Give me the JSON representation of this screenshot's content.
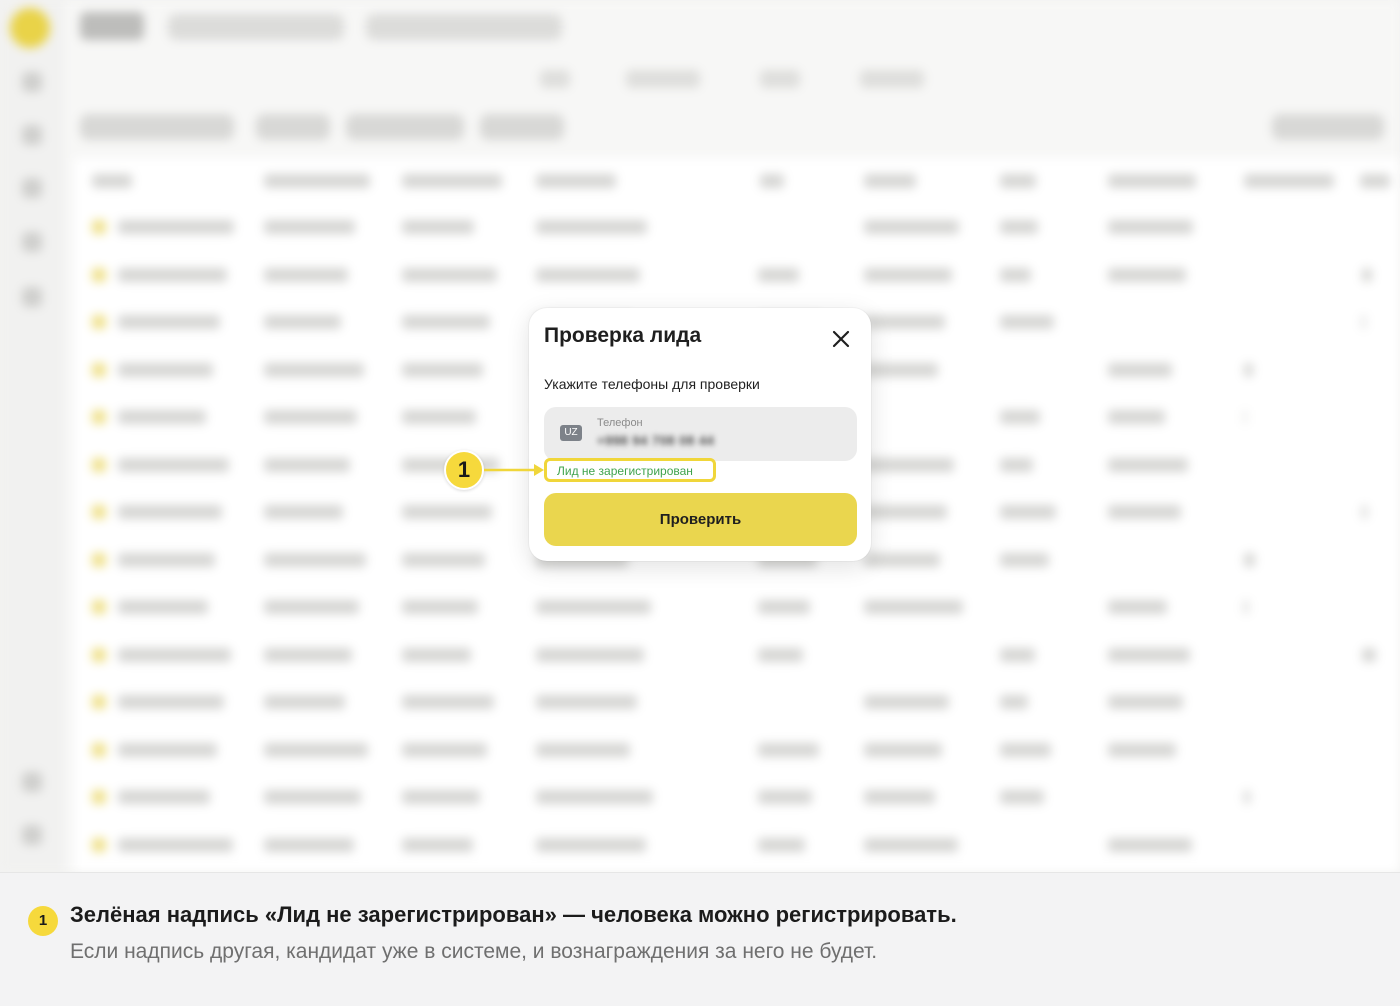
{
  "modal": {
    "title": "Проверка лида",
    "subtitle": "Укажите телефоны для проверки",
    "phone_field": {
      "country_code": "UZ",
      "label": "Телефон",
      "value": "+998 94 708 08 44"
    },
    "status_text": "Лид не зарегистрирован",
    "check_button_label": "Проверить"
  },
  "marker": {
    "number": "1"
  },
  "caption": {
    "badge": "1",
    "heading": "Зелёная надпись «Лид не зарегистрирован» — человека можно регистрировать.",
    "body": "Если надпись другая, кандидат уже в системе, и вознаграждения за него не будет."
  },
  "colors": {
    "accent_yellow": "#ead64e",
    "status_green": "#3fa34d",
    "highlight_border": "#f0d63a"
  },
  "icons": {
    "close": "close-icon",
    "arrow": "arrow-right-icon"
  }
}
